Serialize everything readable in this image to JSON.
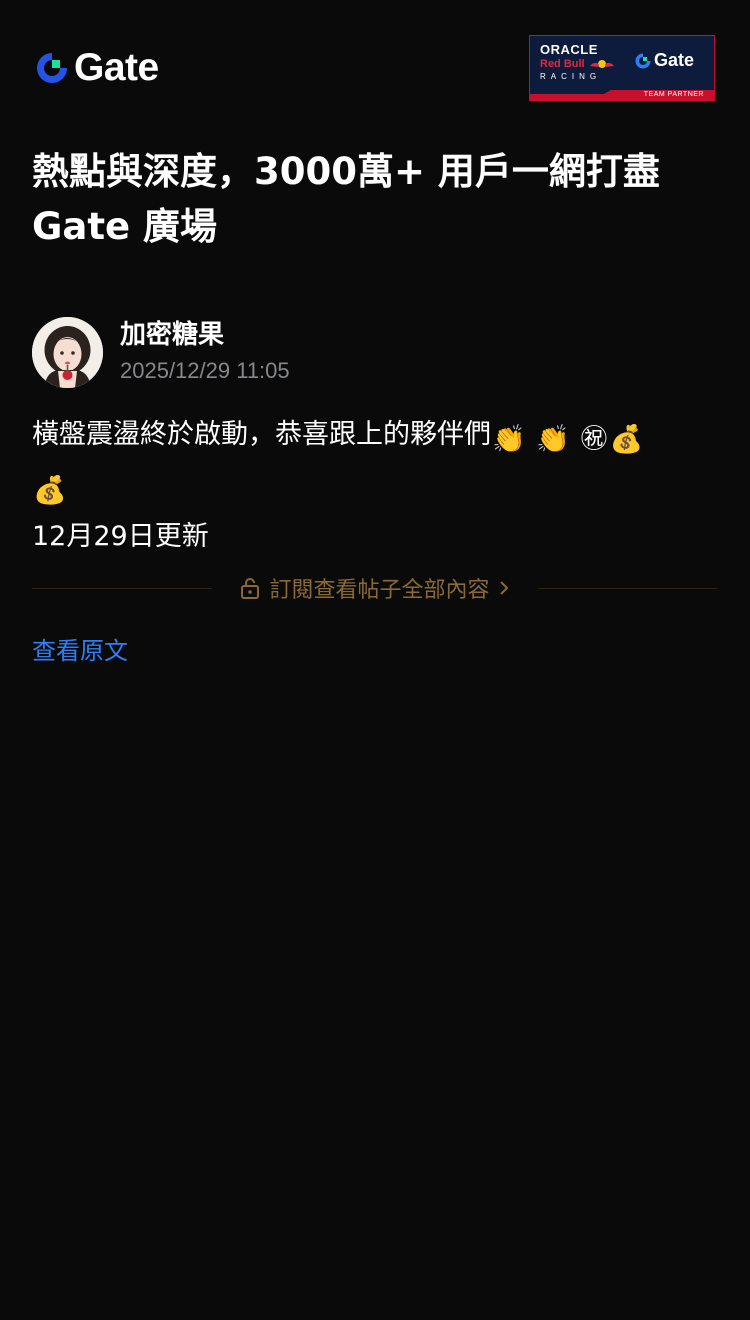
{
  "header": {
    "logo_text": "Gate",
    "partner": {
      "oracle": "ORACLE",
      "red_bull": "Red Bull",
      "racing": "RACING",
      "gate": "Gate",
      "strip": "TEAM PARTNER"
    }
  },
  "headline": {
    "line1": "熱點與深度，3000萬+ 用戶一網打盡",
    "line2": "Gate 廣場"
  },
  "post": {
    "author": "加密糖果",
    "timestamp": "2025/12/29 11:05",
    "text_main": "橫盤震盪終於啟動，恭喜跟上的夥伴們",
    "emoji_clap": "👏",
    "emoji_congrats": "㊗",
    "emoji_money_bag": "💰",
    "update_note": "12月29日更新"
  },
  "subscribe": {
    "label": "訂閱查看帖子全部內容"
  },
  "view_original": "查看原文",
  "colors": {
    "background": "#0a0a0a",
    "brand_blue": "#2354e6",
    "brand_green": "#17e3a3",
    "muted_gold": "#8a6a32",
    "link_blue": "#2d7ff9",
    "timestamp_gray": "#86888c"
  },
  "icons": [
    "gate-logo-icon",
    "lock-icon",
    "chevron-right-icon",
    "avatar-image"
  ]
}
